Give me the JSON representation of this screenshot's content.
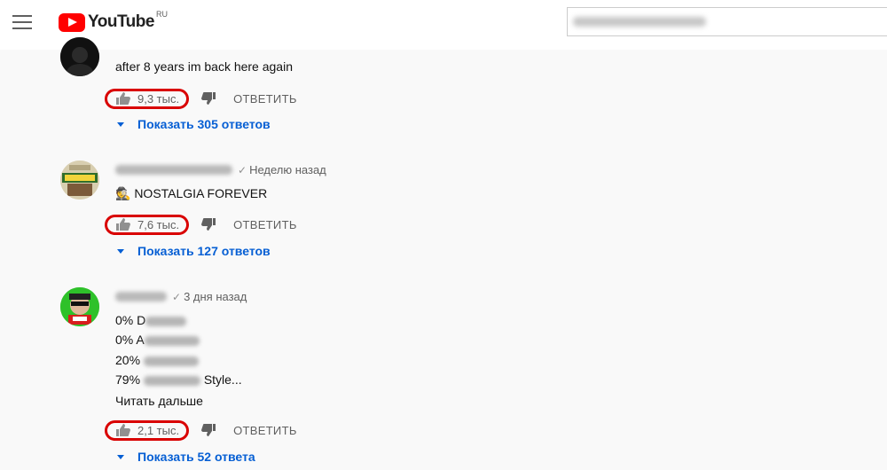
{
  "header": {
    "logo_text": "YouTube",
    "region": "RU",
    "brand_color": "#ff0000"
  },
  "comments": [
    {
      "time": "",
      "lines": [
        "after 8 years im back here again"
      ],
      "likes": "9,3 тыс.",
      "reply_label": "ОТВЕТИТЬ",
      "replies_label": "Показать 305 ответов"
    },
    {
      "time": "Неделю назад",
      "lines": [
        "🕵 NOSTALGIA FOREVER"
      ],
      "likes": "7,6 тыс.",
      "reply_label": "ОТВЕТИТЬ",
      "replies_label": "Показать 127 ответов"
    },
    {
      "time": "3 дня назад",
      "lines": [
        "0% D",
        "0% A",
        "20%",
        "79%",
        "Style..."
      ],
      "read_more": "Читать дальше",
      "likes": "2,1 тыс.",
      "reply_label": "ОТВЕТИТЬ",
      "replies_label": "Показать 52 ответа"
    }
  ],
  "colors": {
    "link": "#065fd4",
    "highlight": "#d90000"
  }
}
